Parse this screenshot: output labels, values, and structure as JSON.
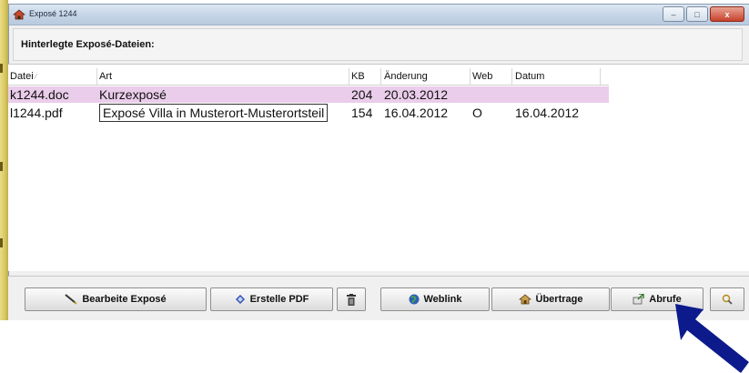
{
  "window": {
    "title": "Exposé 1244",
    "controls": {
      "minimize": "–",
      "maximize": "□",
      "close": "x"
    }
  },
  "header": {
    "label": "Hinterlegte Exposé-Dateien:"
  },
  "table": {
    "columns": [
      "Datei",
      "Art",
      "KB",
      "Änderung",
      "Web",
      "Datum"
    ],
    "rows": [
      {
        "datei": "k1244.doc",
        "art": "Kurzexposé",
        "kb": "204",
        "aenderung": "20.03.2012",
        "web": "",
        "datum": ""
      },
      {
        "datei": "l1244.pdf",
        "art": "Exposé Villa in Musterort-Musterortsteil",
        "kb": "154",
        "aenderung": "16.04.2012",
        "web": "O",
        "datum": "16.04.2012"
      }
    ],
    "colors": {
      "selected_row": "#eacdea"
    }
  },
  "buttons": {
    "bearbeite": "Bearbeite Exposé",
    "erstelle_pdf": "Erstelle PDF",
    "weblink": "Weblink",
    "uebertrage": "Übertrage",
    "abrufe": "Abrufe"
  },
  "annotation": {
    "arrow_color": "#0c1a8c"
  }
}
